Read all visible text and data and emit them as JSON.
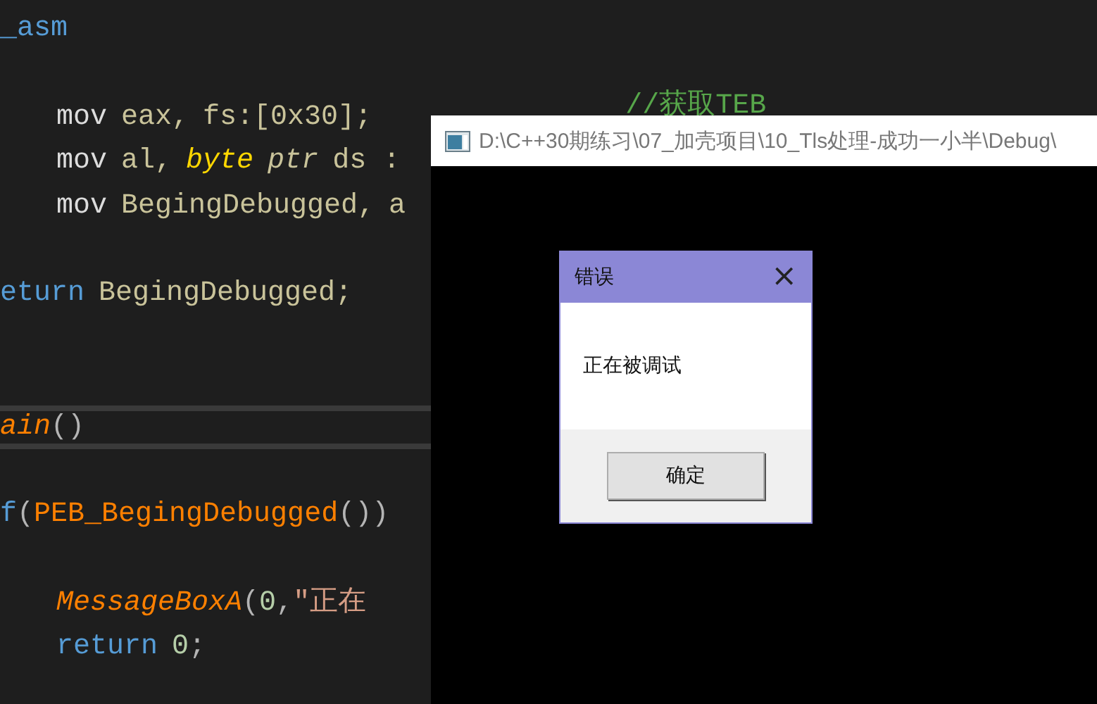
{
  "editor": {
    "lines": [
      {
        "kind": "outer",
        "current": false,
        "tokens": [
          {
            "text": "_asm",
            "kind": "keyword"
          }
        ]
      },
      {
        "kind": "blank",
        "current": false
      },
      {
        "kind": "inner",
        "current": false,
        "tokens": [
          {
            "text": "mov",
            "kind": "plain"
          },
          {
            "text": "eax,",
            "kind": "operand"
          },
          {
            "text": "fs:[0x30];",
            "kind": "operand"
          },
          {
            "text": "//获取TEB",
            "kind": "comment"
          }
        ]
      },
      {
        "kind": "inner",
        "current": false,
        "tokens": [
          {
            "text": "mov",
            "kind": "plain"
          },
          {
            "text": "al,",
            "kind": "operand"
          },
          {
            "text": "byte",
            "kind": "type"
          },
          {
            "text": "ptr",
            "kind": "type_soft"
          },
          {
            "text": "ds :",
            "kind": "operand"
          }
        ]
      },
      {
        "kind": "inner",
        "current": false,
        "tokens": [
          {
            "text": "mov",
            "kind": "plain"
          },
          {
            "text": "BegingDebugged,",
            "kind": "operand"
          },
          {
            "text": "a",
            "kind": "operand"
          }
        ]
      },
      {
        "kind": "blank",
        "current": false
      },
      {
        "kind": "outer",
        "current": false,
        "tokens": [
          {
            "text": "eturn",
            "kind": "keyword"
          },
          {
            "text": "BegingDebugged;",
            "kind": "operand"
          }
        ]
      },
      {
        "kind": "blank",
        "current": false
      },
      {
        "kind": "blank",
        "current": false
      },
      {
        "kind": "outer",
        "current": true,
        "tokens": [
          {
            "text": "ain",
            "kind": "func_italic"
          },
          {
            "text": "()",
            "kind": "punct"
          }
        ]
      },
      {
        "kind": "blank",
        "current": false
      },
      {
        "kind": "outer",
        "current": false,
        "tokens": [
          {
            "text": "f",
            "kind": "keyword"
          },
          {
            "text": "(",
            "kind": "punct"
          },
          {
            "text": "PEB_BegingDebugged",
            "kind": "func"
          },
          {
            "text": "())",
            "kind": "punct"
          }
        ]
      },
      {
        "kind": "blank",
        "current": false
      },
      {
        "kind": "inner",
        "current": false,
        "tokens": [
          {
            "text": "MessageBoxA",
            "kind": "func_italic"
          },
          {
            "text": "(",
            "kind": "punct"
          },
          {
            "text": "0",
            "kind": "number"
          },
          {
            "text": ",",
            "kind": "punct"
          },
          {
            "text": "\"正在",
            "kind": "string"
          }
        ]
      },
      {
        "kind": "inner",
        "current": false,
        "tokens": [
          {
            "text": "return",
            "kind": "keyword"
          },
          {
            "text": "0",
            "kind": "number"
          },
          {
            "text": ";",
            "kind": "punct"
          }
        ]
      }
    ]
  },
  "console": {
    "title": "D:\\C++30期练习\\07_加壳项目\\10_Tls处理-成功一小半\\Debug\\",
    "dialog": {
      "title": "错误",
      "close": "×",
      "message": "正在被调试",
      "button": "确定"
    }
  }
}
